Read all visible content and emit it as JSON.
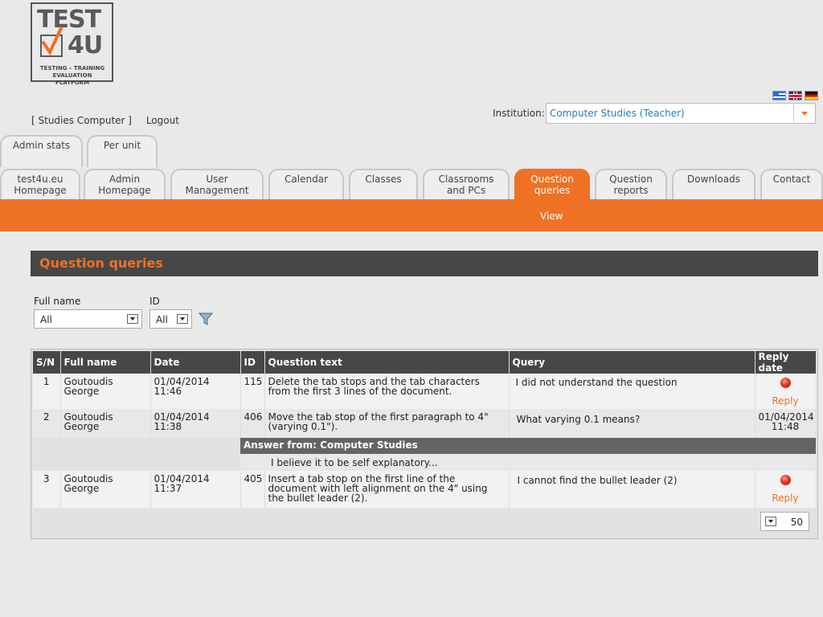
{
  "logo": {
    "line1": "TEST",
    "line2": "4U",
    "subtitle": "TESTING – TRAINING EVALUATION PLATFORM"
  },
  "languages": [
    "Greek",
    "English",
    "German"
  ],
  "institution": {
    "label": "Institution:",
    "value": "Computer Studies (Teacher)"
  },
  "user": {
    "name": "[ Studies Computer ]",
    "logout": "Logout"
  },
  "upper_tabs": [
    "Admin stats",
    "Per unit"
  ],
  "main_tabs": [
    {
      "label": "test4u.eu\nHomepage"
    },
    {
      "label": "Admin\nHomepage"
    },
    {
      "label": "User\nManagement"
    },
    {
      "label": "Calendar"
    },
    {
      "label": "Classes"
    },
    {
      "label": "Classrooms\nand PCs"
    },
    {
      "label": "Question\nqueries",
      "active": true
    },
    {
      "label": "Question\nreports"
    },
    {
      "label": "Downloads"
    },
    {
      "label": "Contact"
    }
  ],
  "subnav": {
    "view": "View"
  },
  "panel": {
    "title": "Question queries"
  },
  "filters": {
    "fullname_label": "Full name",
    "fullname_value": "All",
    "id_label": "ID",
    "id_value": "All"
  },
  "table": {
    "columns": [
      "S/N",
      "Full name",
      "Date",
      "ID",
      "Question text",
      "Query",
      "Reply date"
    ],
    "rows": [
      {
        "sn": "1",
        "name": "Goutoudis George",
        "date": "01/04/2014 11:46",
        "id": "115",
        "question": "Delete the tab stops and the tab characters from the first 3 lines of the document.",
        "query": "I did not understand the question",
        "reply_date": "",
        "reply_label": "Reply"
      },
      {
        "sn": "2",
        "name": "Goutoudis George",
        "date": "01/04/2014 11:38",
        "id": "406",
        "question": "Move the tab stop of the first paragraph to 4\" (varying 0.1\").",
        "query": "What varying 0.1 means?",
        "reply_date": "01/04/2014 11:48",
        "reply_label": "",
        "answer_header": "Answer from: Computer Studies",
        "answer_text": "I believe it to be self explanatory..."
      },
      {
        "sn": "3",
        "name": "Goutoudis George",
        "date": "01/04/2014 11:37",
        "id": "405",
        "question": "Insert a tab stop on the first line of the document with left alignment on the 4\" using the bullet leader (2).",
        "query": "I cannot find the bullet leader (2)",
        "reply_date": "",
        "reply_label": "Reply"
      }
    ]
  },
  "pager": {
    "page_size": "50"
  },
  "colors": {
    "accent": "#ef7123",
    "header_dark": "#474747",
    "link_blue": "#1f7fbf"
  }
}
